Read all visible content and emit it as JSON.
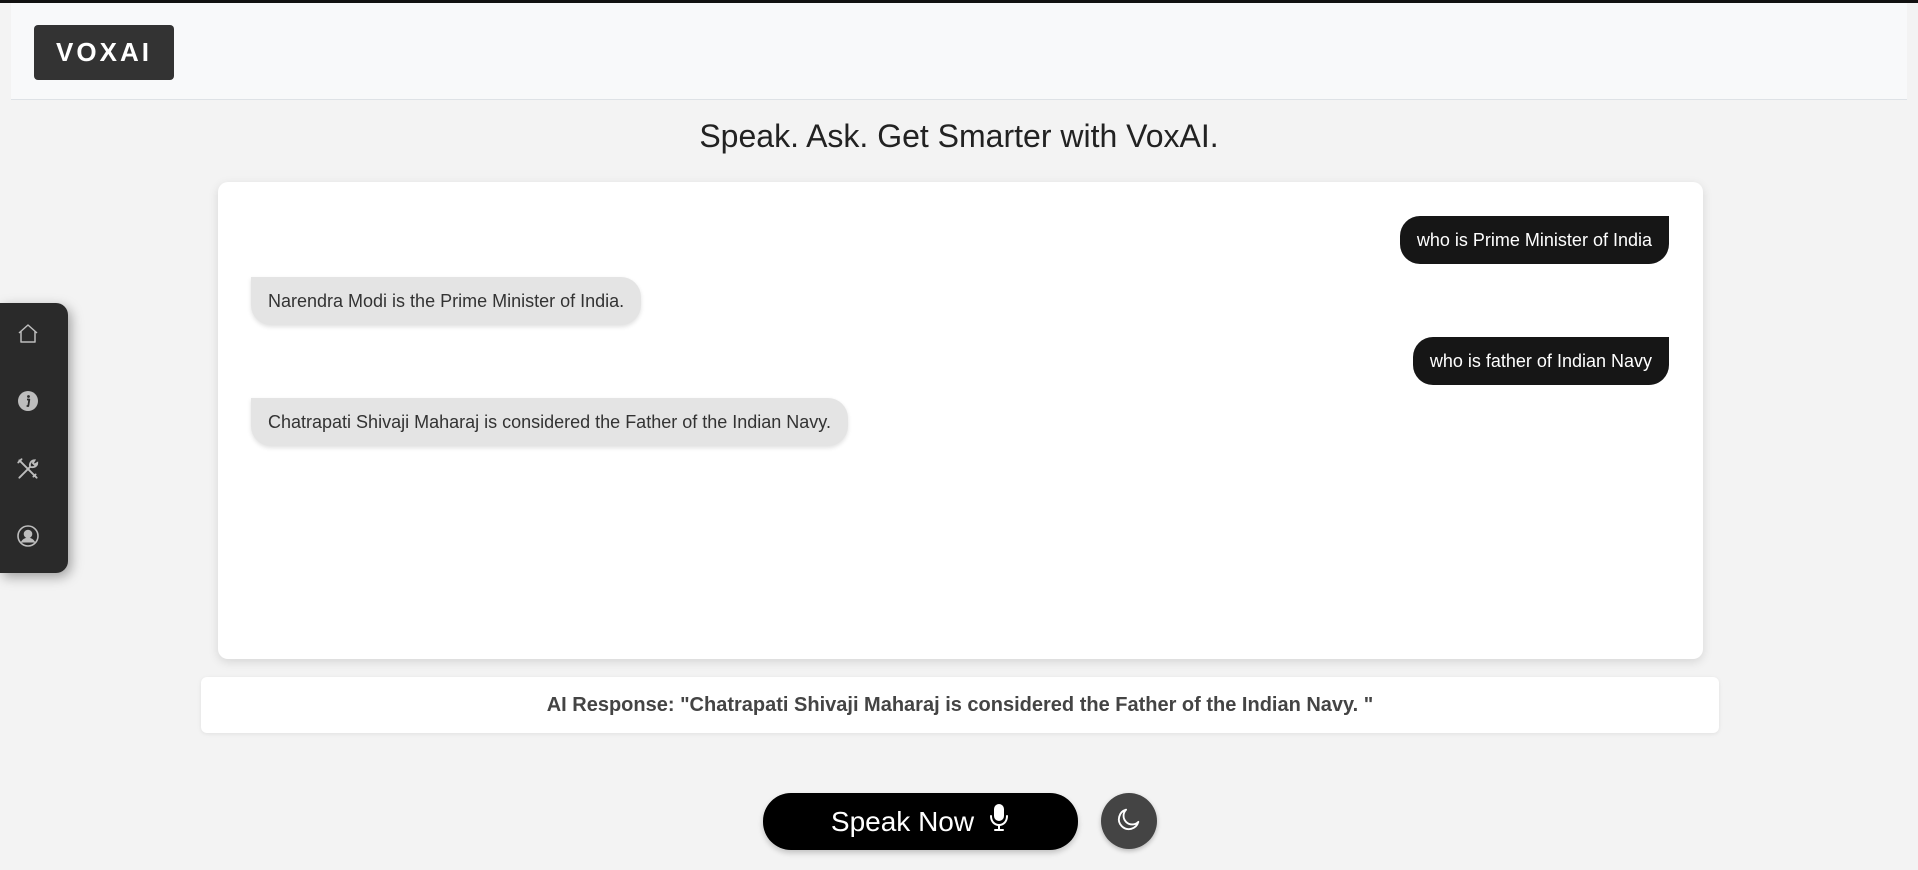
{
  "app": {
    "logo_text": "VOXAI",
    "headline": "Speak. Ask. Get Smarter with VoxAI."
  },
  "sidebar": {
    "items": [
      {
        "icon": "home-icon"
      },
      {
        "icon": "info-icon"
      },
      {
        "icon": "tools-icon"
      },
      {
        "icon": "user-icon"
      }
    ]
  },
  "chat": {
    "messages": [
      {
        "role": "user",
        "text": "who is Prime Minister of India"
      },
      {
        "role": "ai",
        "text": "Narendra Modi is the Prime Minister of India."
      },
      {
        "role": "user",
        "text": "who is father of Indian Navy"
      },
      {
        "role": "ai",
        "text": "Chatrapati Shivaji Maharaj is considered the Father of the Indian Navy."
      }
    ]
  },
  "response": {
    "text": "AI Response: \"Chatrapati Shivaji Maharaj is considered the Father of the Indian Navy. \""
  },
  "controls": {
    "speak_label": "Speak Now",
    "mic_icon": "microphone-icon",
    "theme_icon": "moon-icon"
  },
  "colors": {
    "background": "#f3f3f3",
    "user_bubble": "#161616",
    "ai_bubble": "#e4e4e4",
    "sidebar": "#2a2a2a",
    "speak_button": "#000000",
    "theme_button": "#444444"
  }
}
